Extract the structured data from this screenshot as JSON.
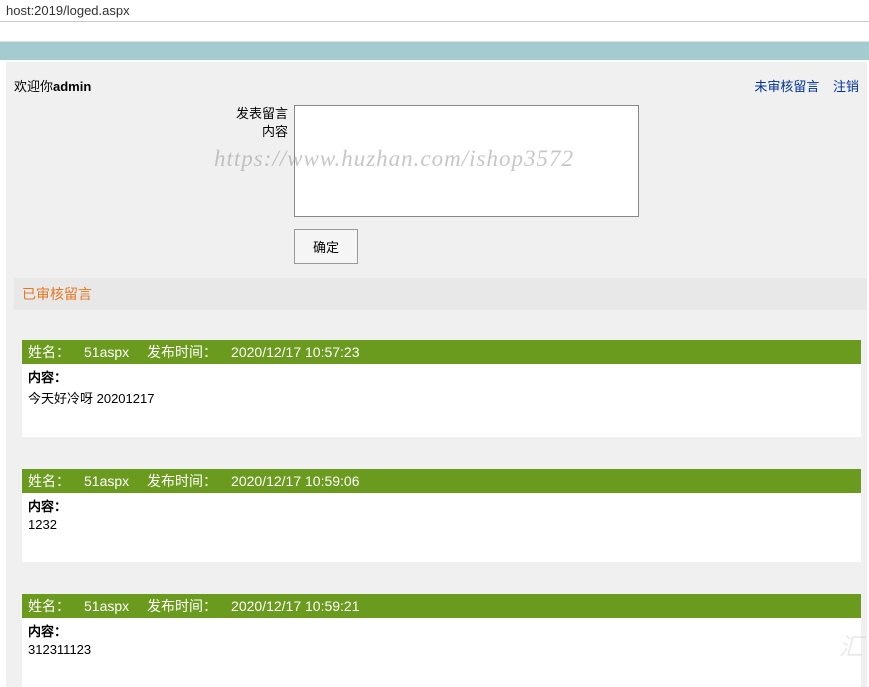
{
  "url": "host:2019/loged.aspx",
  "welcome_prefix": "欢迎你",
  "welcome_user": "admin",
  "links": {
    "pending": "未审核留言",
    "logout": "注销"
  },
  "form": {
    "title": "发表留言",
    "content_label": "内容",
    "submit": "确定"
  },
  "section_title": "已审核留言",
  "content_label": "内容：",
  "name_label": "姓名：",
  "time_label": "发布时间：",
  "messages": [
    {
      "name": "51aspx",
      "time": "2020/12/17 10:57:23",
      "content": "今天好冷呀 20201217"
    },
    {
      "name": "51aspx",
      "time": "2020/12/17 10:59:06",
      "content": "1232"
    },
    {
      "name": "51aspx",
      "time": "2020/12/17 10:59:21",
      "content": "312311123"
    }
  ],
  "watermark": "https://www.huzhan.com/ishop3572"
}
